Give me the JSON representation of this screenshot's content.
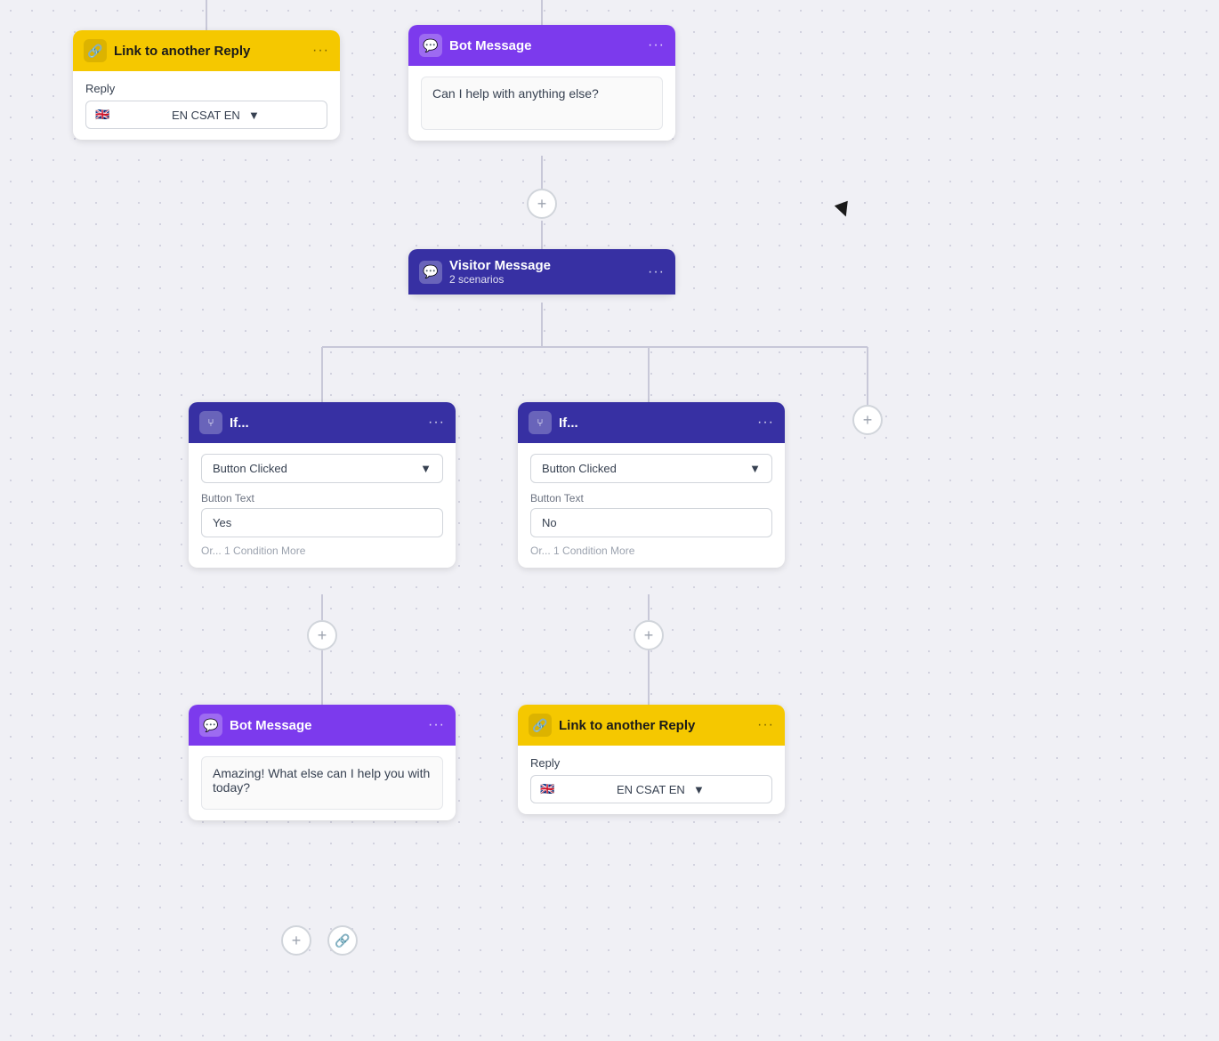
{
  "nodes": {
    "link_reply_top": {
      "title": "Link to another Reply",
      "reply_label": "Reply",
      "select_value": "EN CSAT EN",
      "flag": "🇬🇧"
    },
    "bot_message_top": {
      "title": "Bot Message",
      "text": "Can I help with anything else?"
    },
    "visitor_message": {
      "title": "Visitor Message",
      "subtitle": "2 scenarios"
    },
    "if_left": {
      "title": "If...",
      "dropdown_value": "Button Clicked",
      "field_label": "Button Text",
      "field_value": "Yes",
      "condition_more": "Or...  1 Condition More"
    },
    "if_right": {
      "title": "If...",
      "dropdown_value": "Button Clicked",
      "field_label": "Button Text",
      "field_value": "No",
      "condition_more": "Or...  1 Condition More"
    },
    "bot_message_bottom": {
      "title": "Bot Message",
      "text": "Amazing! What else can I help you with today?"
    },
    "link_reply_bottom": {
      "title": "Link to another Reply",
      "reply_label": "Reply",
      "select_value": "EN CSAT EN",
      "flag": "🇬🇧"
    }
  },
  "buttons": {
    "plus1": "+",
    "plus2": "+",
    "plus3": "+",
    "plus4": "+",
    "plus5": "+"
  },
  "icons": {
    "message": "💬",
    "link": "🔗",
    "branch": "⑂",
    "dots": "···"
  }
}
